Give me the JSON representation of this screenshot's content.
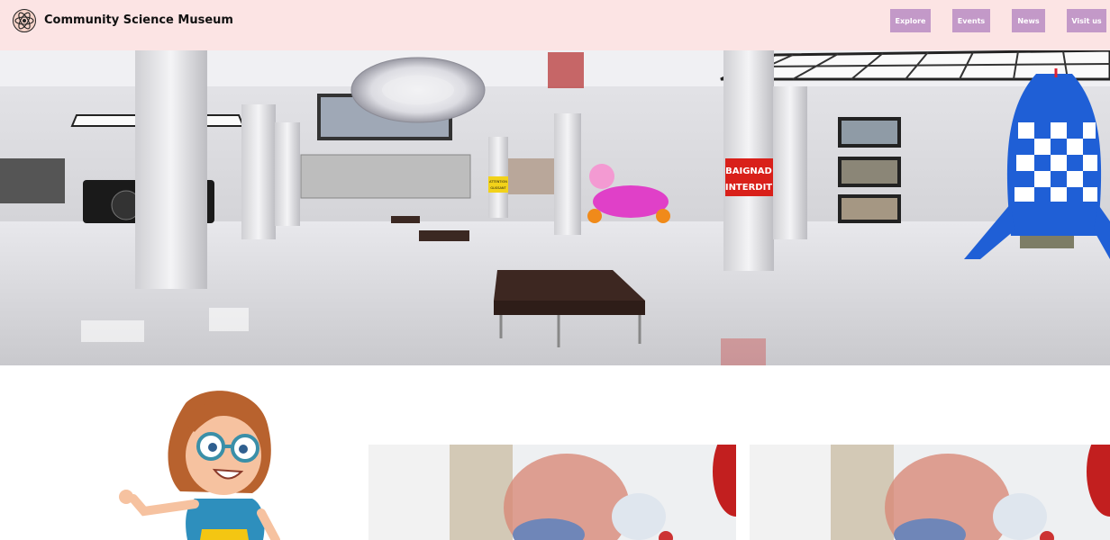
{
  "header": {
    "title": "Community Science Museum",
    "nav": [
      {
        "label": "Explore"
      },
      {
        "label": "Events"
      },
      {
        "label": "News"
      },
      {
        "label": "Visit us"
      }
    ]
  },
  "hero": {
    "signs": {
      "baignade_line1": "BAIGNAD",
      "baignade_line2": "INTERDIT",
      "attention_line1": "ATTENTION",
      "attention_line2": "GLISSANT"
    }
  },
  "colors": {
    "header_bg": "#fce4e4",
    "nav_button": "#c399c8",
    "rocket_blue": "#1f5fd6",
    "toy_pink": "#e040c8"
  },
  "icons": {
    "logo": "atom-icon"
  }
}
